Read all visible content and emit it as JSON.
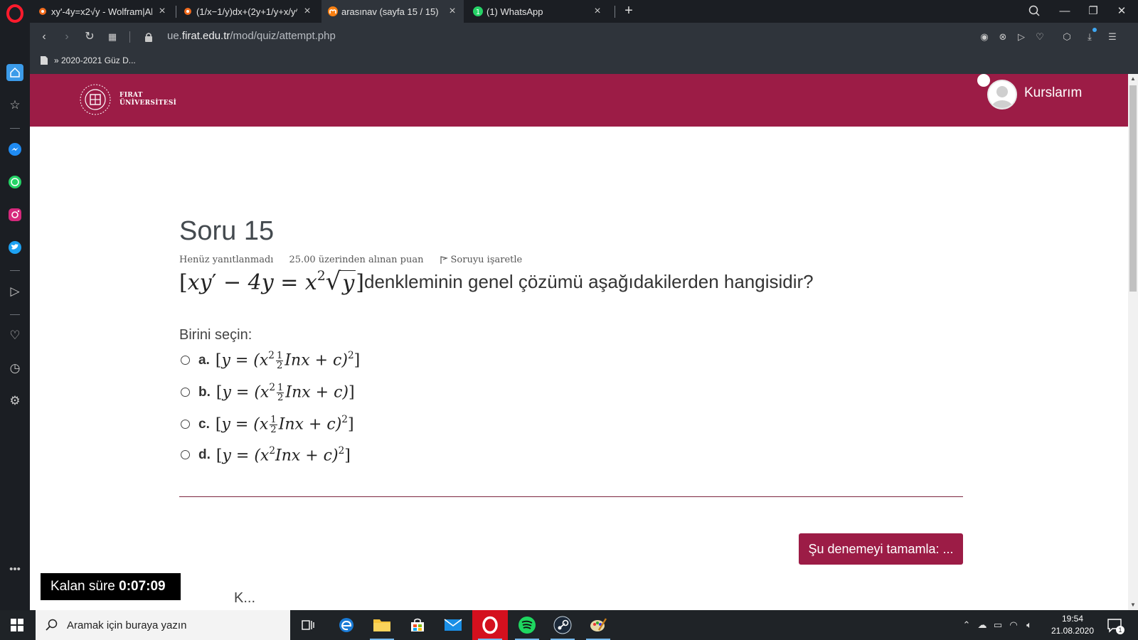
{
  "browser": {
    "tabs": [
      {
        "title": "xy'-4y=x2√y - Wolfram|Alp",
        "active": false
      },
      {
        "title": "(1/x−1/y)dx+(2y+1/y+x/y^",
        "active": false
      },
      {
        "title": "arasınav (sayfa 15 / 15)",
        "active": true
      },
      {
        "title": "(1) WhatsApp",
        "active": false
      }
    ],
    "url_prefix": "ue.",
    "url_domain": "firat.edu.tr",
    "url_path": "/mod/quiz/attempt.php",
    "bookmark": "» 2020-2021 Güz D..."
  },
  "site": {
    "logo_line1": "FIRAT",
    "logo_line2": "ÜNİVERSİTESİ",
    "courses_label": "Kurslarım"
  },
  "question": {
    "title": "Soru 15",
    "status": "Henüz yanıtlanmadı",
    "points": "25.00 üzerinden alınan puan",
    "flag_label": "Soruyu işaretle",
    "equation": {
      "lhs_a": "xy",
      "prime": "′",
      "minus_term": "− 4y",
      "equals": "=",
      "rhs_base": "x",
      "rhs_exp": "2",
      "sqrt_arg": "y"
    },
    "text": "denkleminin genel çözümü aşağıdakilerden hangisidir?",
    "choose_label": "Birini seçin:",
    "options": [
      {
        "letter": "a.",
        "pre": "y = (x",
        "exp1": "2",
        "frac_num": "1",
        "frac_den": "2",
        "post": "Inx + c)",
        "exp2": "2"
      },
      {
        "letter": "b.",
        "pre": "y = (x",
        "exp1": "2",
        "frac_num": "1",
        "frac_den": "2",
        "post": "Inx + c)",
        "exp2": ""
      },
      {
        "letter": "c.",
        "pre": "y = (x",
        "exp1": "",
        "frac_num": "1",
        "frac_den": "2",
        "post": "Inx + c)",
        "exp2": "2"
      },
      {
        "letter": "d.",
        "pre": "y = (x",
        "exp1": "2",
        "frac_num": "",
        "frac_den": "",
        "post": "Inx + c)",
        "exp2": "2"
      }
    ],
    "finish_button": "Şu denemeyi tamamla: ...",
    "timer_label": "Kalan süre",
    "timer_value": "0:07:09",
    "cut_text": "K..."
  },
  "taskbar": {
    "search_placeholder": "Aramak için buraya yazın",
    "time": "19:54",
    "date": "21.08.2020",
    "notification_count": "1"
  },
  "colors": {
    "brand": "#9c1c46",
    "browser_dark": "#1b1e23",
    "browser_panel": "#2f343b",
    "taskbar": "#1f2327"
  }
}
